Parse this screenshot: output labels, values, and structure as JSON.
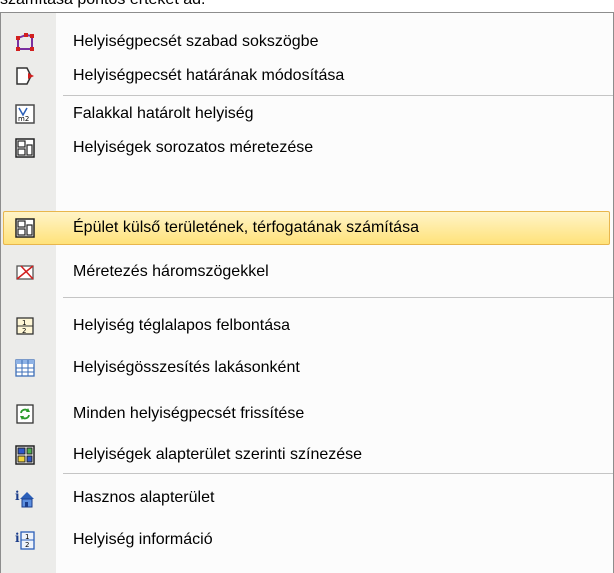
{
  "header": {
    "partial_text": "számítása pontos értéket ad."
  },
  "menu": {
    "items": [
      {
        "label": "Helyiségpecsét szabad sokszögbe",
        "icon": "polygon-stamp-icon"
      },
      {
        "label": "Helyiségpecsét határának módosítása",
        "icon": "boundary-edit-icon"
      },
      {
        "label": "Falakkal határolt helyiség",
        "icon": "room-m2-icon"
      },
      {
        "label": "Helyiségek sorozatos méretezése",
        "icon": "room-layout-icon"
      },
      {
        "label": "Épület külső területének, térfogatának számítása",
        "icon": "building-calc-icon",
        "highlighted": true
      },
      {
        "label": "Méretezés háromszögekkel",
        "icon": "triangle-icon"
      },
      {
        "label": "Helyiség téglalapos felbontása",
        "icon": "rect-split-icon"
      },
      {
        "label": "Helyiségösszesítés lakásonként",
        "icon": "table-icon"
      },
      {
        "label": "Minden helyiségpecsét frissítése",
        "icon": "refresh-icon"
      },
      {
        "label": "Helyiségek alapterület szerinti színezése",
        "icon": "color-map-icon"
      },
      {
        "label": "Hasznos alapterület",
        "icon": "info-house-icon"
      },
      {
        "label": "Helyiség információ",
        "icon": "info-room-icon"
      }
    ]
  }
}
